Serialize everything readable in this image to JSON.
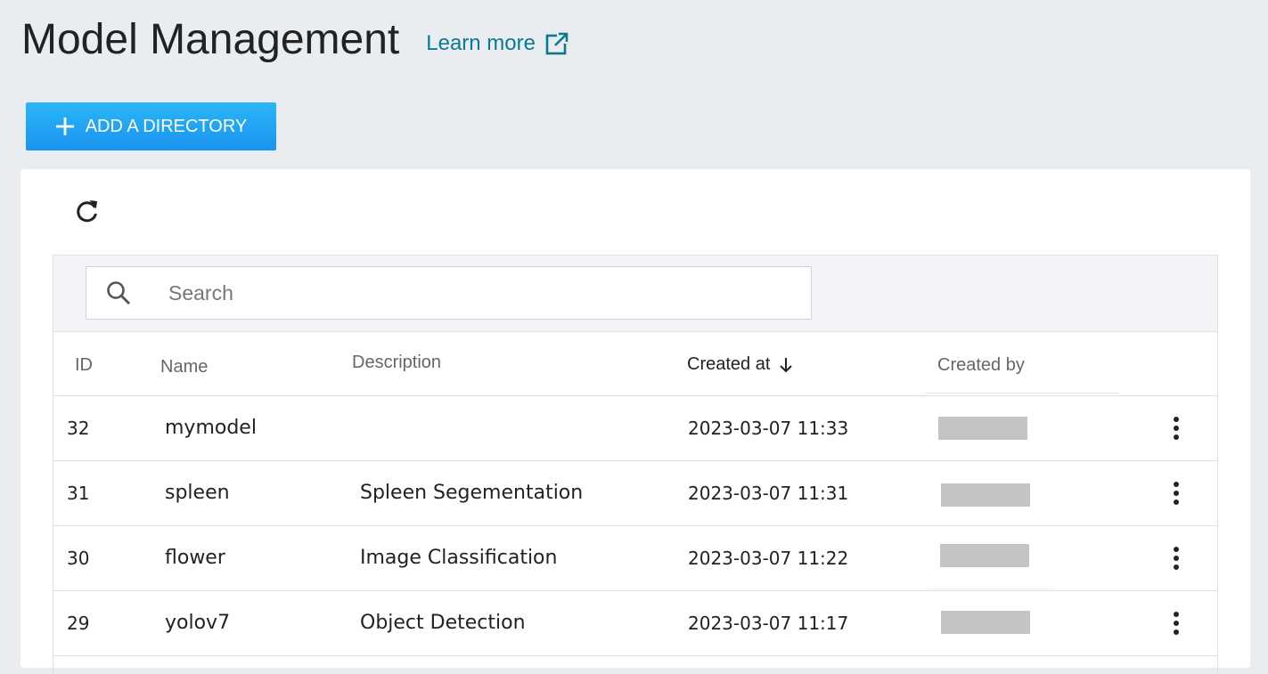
{
  "header": {
    "title": "Model Management",
    "learn_more": "Learn more"
  },
  "toolbar": {
    "add_directory_label": "ADD A DIRECTORY"
  },
  "search": {
    "placeholder": "Search",
    "value": ""
  },
  "table": {
    "columns": {
      "id": "ID",
      "name": "Name",
      "description": "Description",
      "created_at": "Created at",
      "created_by": "Created by"
    },
    "sort": {
      "column": "created_at",
      "direction": "descending"
    },
    "rows": [
      {
        "id": "32",
        "name": "mymodel",
        "description": "",
        "created_at": "2023-03-07 11:33"
      },
      {
        "id": "31",
        "name": "spleen",
        "description": "Spleen Segementation",
        "created_at": "2023-03-07 11:31"
      },
      {
        "id": "30",
        "name": "flower",
        "description": "Image Classification",
        "created_at": "2023-03-07 11:22"
      },
      {
        "id": "29",
        "name": "yolov7",
        "description": "Object Detection",
        "created_at": "2023-03-07 11:17"
      }
    ]
  },
  "icons": {
    "external_link": "external-link-icon",
    "add": "plus-icon",
    "refresh": "refresh-icon",
    "search": "search-icon",
    "sort": "arrow-down-icon",
    "row_menu": "more-vertical-icon"
  },
  "colors": {
    "page_background": "#e9edf0",
    "link": "#0a7a94",
    "primary_button": "#1fa4f3",
    "redaction": "#c4c4c4"
  }
}
